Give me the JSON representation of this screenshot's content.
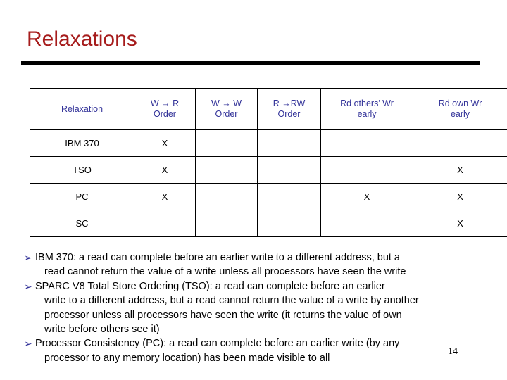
{
  "slide": {
    "title": "Relaxations",
    "page_number": "14",
    "title_color": "#a61c1c",
    "header_text_color": "#333399",
    "bullet_glyph_color": "#333399",
    "rule_color": "#000000"
  },
  "table": {
    "columns": [
      {
        "label": "Relaxation",
        "line2": ""
      },
      {
        "label": "W → R",
        "line2": "Order"
      },
      {
        "label": "W → W",
        "line2": "Order"
      },
      {
        "label": "R →RW",
        "line2": "Order"
      },
      {
        "label": "Rd others’ Wr",
        "line2": "early"
      },
      {
        "label": "Rd own Wr",
        "line2": "early"
      }
    ],
    "rows": [
      {
        "name": "IBM 370",
        "cells": [
          "X",
          "",
          "",
          "",
          ""
        ]
      },
      {
        "name": "TSO",
        "cells": [
          "X",
          "",
          "",
          "",
          "X"
        ]
      },
      {
        "name": "PC",
        "cells": [
          "X",
          "",
          "",
          "X",
          "X"
        ]
      },
      {
        "name": "SC",
        "cells": [
          "",
          "",
          "",
          "",
          "X"
        ]
      }
    ]
  },
  "bullets": [
    {
      "glyph": "➢",
      "line1": "IBM 370: a read can complete before an earlier write to a different address, but a",
      "lines": [
        "read cannot return the value of a write unless all processors have seen the write"
      ]
    },
    {
      "glyph": "➢",
      "line1": "SPARC V8 Total Store Ordering (TSO): a read can complete before an earlier",
      "lines": [
        "write to a different address, but a read cannot return the value of a write by another",
        "processor unless all processors have seen the write (it returns the value of own",
        "write before others see it)"
      ]
    },
    {
      "glyph": "➢",
      "line1": "Processor Consistency (PC): a read can complete before an earlier write (by any",
      "lines": [
        "processor to any memory location) has been made visible to all"
      ]
    }
  ]
}
